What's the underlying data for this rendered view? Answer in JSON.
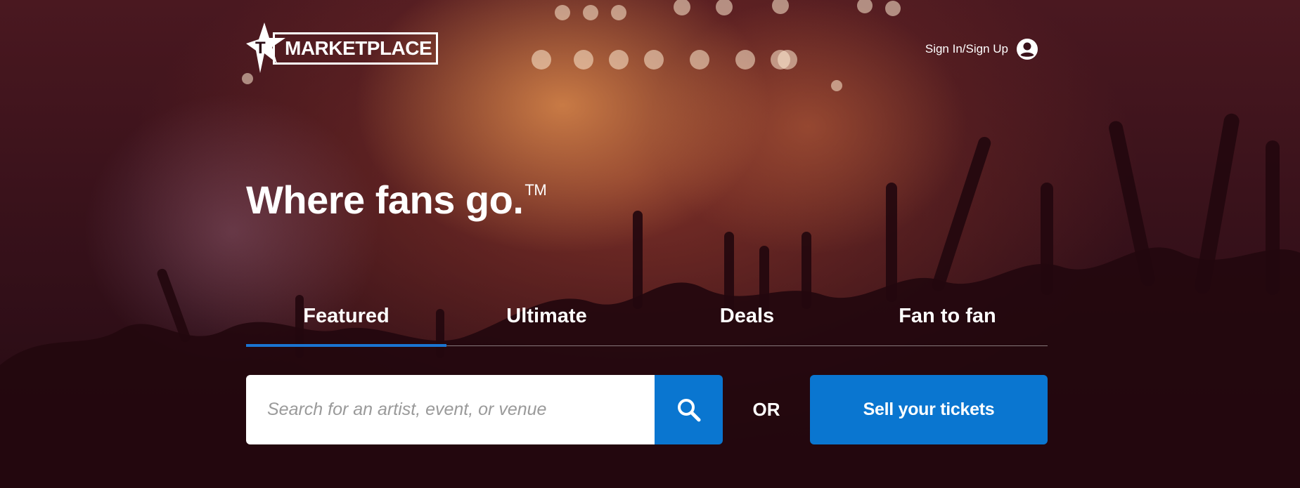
{
  "brand": {
    "logo_text": "MARKETPLACE",
    "logo_letter": "T"
  },
  "header": {
    "signin_label": "Sign In/Sign Up"
  },
  "hero": {
    "headline": "Where fans go.",
    "trademark": "TM"
  },
  "tabs": [
    {
      "label": "Featured",
      "active": true
    },
    {
      "label": "Ultimate",
      "active": false
    },
    {
      "label": "Deals",
      "active": false
    },
    {
      "label": "Fan to fan",
      "active": false
    }
  ],
  "search": {
    "placeholder": "Search for an artist, event, or venue",
    "value": ""
  },
  "or_label": "OR",
  "sell_button": "Sell your tickets",
  "colors": {
    "accent": "#0a76d0",
    "tab_underline": "#1a75d2"
  },
  "icons": {
    "search": "search-icon",
    "account": "account-circle-icon",
    "logo": "star-icon"
  }
}
